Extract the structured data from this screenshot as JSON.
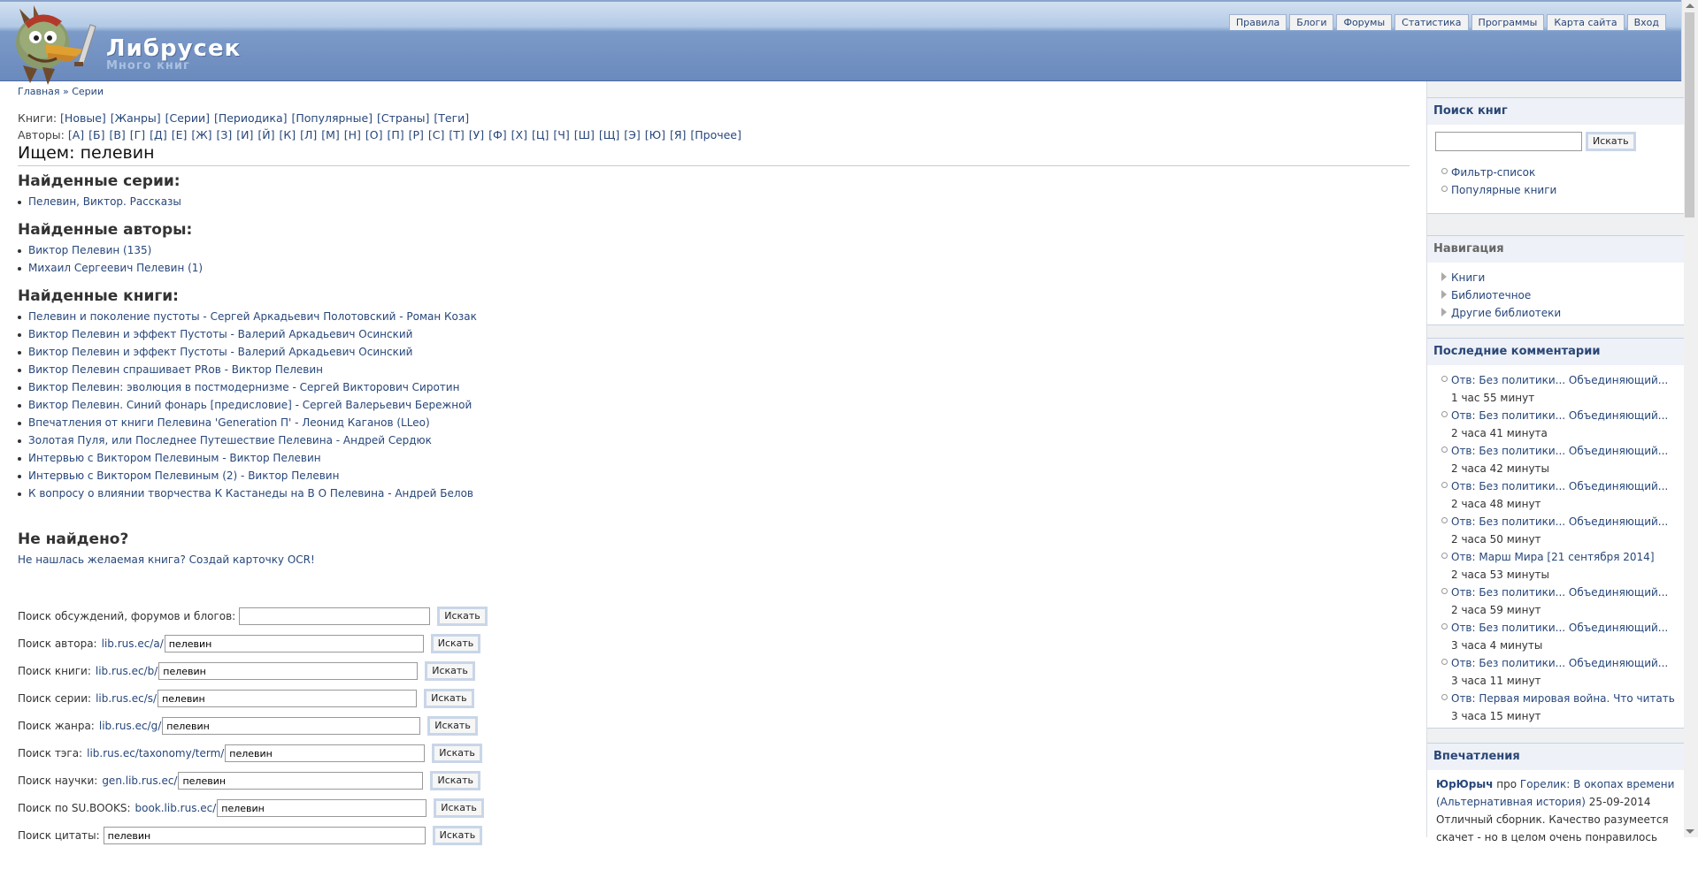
{
  "header": {
    "site_name": "Либрусек",
    "slogan": "Много книг",
    "topnav": [
      "Правила",
      "Блоги",
      "Форумы",
      "Статистика",
      "Программы",
      "Карта сайта",
      "Вход"
    ]
  },
  "breadcrumb": "Главная » Серии",
  "books_line": {
    "label": "Книги:",
    "items": [
      "[Новые]",
      "[Жанры]",
      "[Серии]",
      "[Периодика]",
      "[Популярные]",
      "[Страны]",
      "[Теги]"
    ]
  },
  "authors_line": {
    "label": "Авторы:",
    "items": [
      "[А]",
      "[Б]",
      "[В]",
      "[Г]",
      "[Д]",
      "[Е]",
      "[Ж]",
      "[З]",
      "[И]",
      "[Й]",
      "[К]",
      "[Л]",
      "[М]",
      "[Н]",
      "[О]",
      "[П]",
      "[Р]",
      "[С]",
      "[Т]",
      "[У]",
      "[Ф]",
      "[Х]",
      "[Ц]",
      "[Ч]",
      "[Ш]",
      "[Щ]",
      "[Э]",
      "[Ю]",
      "[Я]",
      "[Прочее]"
    ]
  },
  "page_title": "Ищем: пелевин",
  "series": {
    "heading": "Найденные серии:",
    "items": [
      "Пелевин, Виктор. Рассказы"
    ]
  },
  "authors": {
    "heading": "Найденные авторы:",
    "items": [
      "Виктор Пелевин (135)",
      "Михаил Сергеевич Пелевин (1)"
    ]
  },
  "books": {
    "heading": "Найденные книги:",
    "items": [
      "Пелевин и поколение пустоты - Сергей Аркадьевич Полотовский - Роман Козак",
      "Виктор Пелевин и эффект Пустоты - Валерий Аркадьевич Осинский",
      "Виктор Пелевин и эффект Пустоты - Валерий Аркадьевич Осинский",
      "Виктор Пелевин спрашивает PRов - Виктор Пелевин",
      "Виктор Пелевин: эволюция в постмодернизме - Сергей Викторович Сиротин",
      "Виктор Пелевин. Синий фонарь [предисловие] - Сергей Валерьевич Бережной",
      "Впечатления от книги Пелевина 'Generation П' - Леонид Каганов (LLeo)",
      "Золотая Пуля, или Последнее Путешествие Пелевина - Андрей Сердюк",
      "Интервью с Виктором Пелевиным - Виктор Пелевин",
      "Интервью с Виктором Пелевиным (2) - Виктор Пелевин",
      "К вопросу о влиянии творчества К Кастанеды на В О Пелевина - Андрей Белов"
    ]
  },
  "not_found": {
    "heading": "Не найдено?",
    "text": "Не нашлась желаемая книга? Создай карточку OCR!"
  },
  "search_forms": {
    "button": "Искать",
    "rows": [
      {
        "label": "Поиск обсуждений, форумов и блогов:",
        "host": "",
        "value": ""
      },
      {
        "label": "Поиск автора:",
        "host": "lib.rus.ec/a/",
        "value": "пелевин"
      },
      {
        "label": "Поиск книги:",
        "host": "lib.rus.ec/b/",
        "value": "пелевин"
      },
      {
        "label": "Поиск серии:",
        "host": "lib.rus.ec/s/",
        "value": "пелевин"
      },
      {
        "label": "Поиск жанра:",
        "host": "lib.rus.ec/g/",
        "value": "пелевин"
      },
      {
        "label": "Поиск тэга:",
        "host": "lib.rus.ec/taxonomy/term/",
        "value": "пелевин"
      },
      {
        "label": "Поиск научки:",
        "host": "gen.lib.rus.ec/",
        "value": "пелевин"
      },
      {
        "label": "Поиск по SU.BOOKS:",
        "host": "book.lib.rus.ec/",
        "value": "пелевин"
      },
      {
        "label": "Поиск цитаты:",
        "host": "",
        "value": "пелевин"
      }
    ]
  },
  "sidebar": {
    "search": {
      "title": "Поиск книг",
      "button": "Искать",
      "links": [
        "Фильтр-список",
        "Популярные книги"
      ]
    },
    "navigation": {
      "title": "Навигация",
      "links": [
        "Книги",
        "Библиотечное",
        "Другие библиотеки"
      ]
    },
    "comments": {
      "title": "Последние комментарии",
      "items": [
        {
          "link": "Отв: Без политики... Объединяющий...",
          "time": "1 час 55 минут"
        },
        {
          "link": "Отв: Без политики... Объединяющий...",
          "time": "2 часа 41 минута"
        },
        {
          "link": "Отв: Без политики... Объединяющий...",
          "time": "2 часа 42 минуты"
        },
        {
          "link": "Отв: Без политики... Объединяющий...",
          "time": "2 часа 48 минут"
        },
        {
          "link": "Отв: Без политики... Объединяющий...",
          "time": "2 часа 50 минут"
        },
        {
          "link": "Отв: Марш Мира [21 сентября 2014]",
          "time": "2 часа 53 минуты"
        },
        {
          "link": "Отв: Без политики... Объединяющий...",
          "time": "2 часа 59 минут"
        },
        {
          "link": "Отв: Без политики... Объединяющий...",
          "time": "3 часа 4 минуты"
        },
        {
          "link": "Отв: Без политики... Объединяющий...",
          "time": "3 часа 11 минут"
        },
        {
          "link": "Отв: Первая мировая война. Что читать",
          "time": "3 часа 15 минут"
        }
      ]
    },
    "impressions": {
      "title": "Впечатления",
      "user": "ЮрЮрыч",
      "pro": "про",
      "book": "Горелик: В окопах времени (Альтернативная история)",
      "date": "25-09-2014",
      "text": "Отличный сборник. Качество разумеется скачет - но в целом очень понравилось"
    }
  },
  "colors": {
    "link": "#27477a",
    "header_bg": "#6a8abd",
    "sidebar_title": "#2a4777"
  }
}
